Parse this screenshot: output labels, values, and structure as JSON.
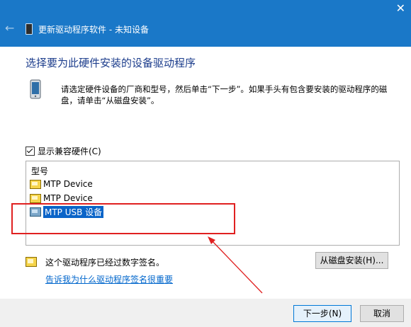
{
  "window": {
    "title": "更新驱动程序软件 - 未知设备",
    "close_glyph": "✕",
    "back_glyph": "←"
  },
  "heading": "选择要为此硬件安装的设备驱动程序",
  "description": "请选定硬件设备的厂商和型号，然后单击“下一步”。如果手头有包含要安装的驱动程序的磁盘，请单击“从磁盘安装”。",
  "show_compatible": {
    "label": "显示兼容硬件(C)",
    "checked": true
  },
  "model_list": {
    "header": "型号",
    "items": [
      {
        "label": "MTP Device",
        "selected": false
      },
      {
        "label": "MTP Device",
        "selected": false
      },
      {
        "label": "MTP USB 设备",
        "selected": true
      }
    ]
  },
  "signed_text": "这个驱动程序已经过数字签名。",
  "link_text": "告诉我为什么驱动程序签名很重要",
  "buttons": {
    "have_disk": "从磁盘安装(H)...",
    "next": "下一步(N)",
    "cancel": "取消"
  },
  "colors": {
    "titlebar": "#1a78c8",
    "heading": "#1c3d8c",
    "selection": "#0a64c8",
    "annotation": "#e02020"
  }
}
